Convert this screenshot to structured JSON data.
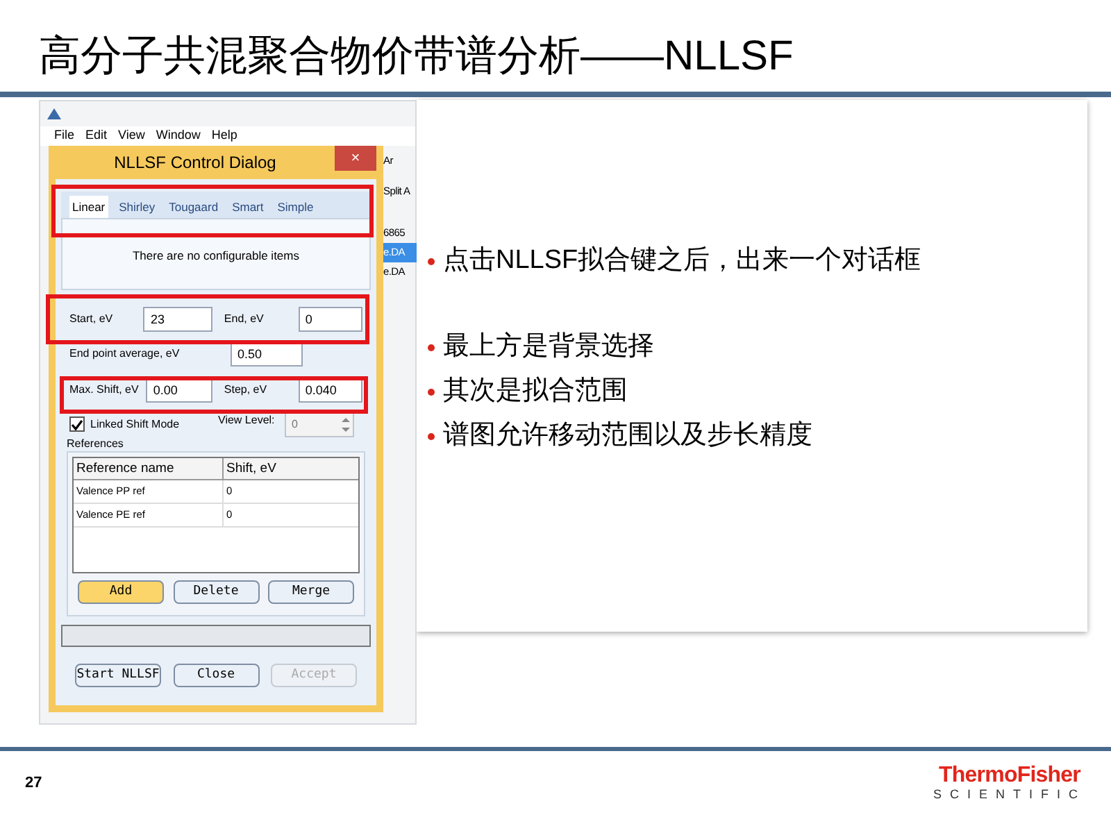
{
  "slide_title": "高分子共混聚合物价带谱分析——NLLSF",
  "app": {
    "menu": [
      "File",
      "Edit",
      "View",
      "Window",
      "Help"
    ],
    "fragments": [
      {
        "text": "Ar",
        "selected": false
      },
      {
        "text": "Split A",
        "selected": false
      },
      {
        "text": "6865",
        "selected": false
      },
      {
        "text": "e.DA",
        "selected": true
      },
      {
        "text": "e.DA",
        "selected": false
      }
    ]
  },
  "dialog": {
    "title": "NLLSF Control Dialog",
    "close": "×",
    "tabs": [
      {
        "label": "Linear",
        "selected": true
      },
      {
        "label": "Shirley",
        "selected": false
      },
      {
        "label": "Tougaard",
        "selected": false
      },
      {
        "label": "Smart",
        "selected": false
      },
      {
        "label": "Simple",
        "selected": false
      }
    ],
    "tab_message": "There are no configurable items",
    "start": {
      "label": "Start, eV",
      "value": "23"
    },
    "end": {
      "label": "End, eV",
      "value": "0"
    },
    "end_point_average": {
      "label": "End point average, eV",
      "value": "0.50"
    },
    "max_shift": {
      "label": "Max. Shift, eV",
      "value": "0.00"
    },
    "step": {
      "label": "Step, eV",
      "value": "0.040"
    },
    "linked_shift": {
      "label": "Linked Shift Mode",
      "checked": true
    },
    "view_level": {
      "label": "View Level:",
      "value": "0",
      "disabled": true
    },
    "references": {
      "label": "References",
      "columns": [
        "Reference name",
        "Shift, eV"
      ],
      "rows": [
        [
          "Valence PP ref",
          "0"
        ],
        [
          "Valence PE ref",
          "0"
        ]
      ]
    },
    "progress": {
      "level": 0
    },
    "ref_buttons": [
      {
        "label": "Add",
        "selected": true,
        "disabled": false
      },
      {
        "label": "Delete",
        "selected": false,
        "disabled": false
      },
      {
        "label": "Merge",
        "selected": false,
        "disabled": false
      }
    ],
    "bottom_buttons": [
      {
        "label": "Start NLLSF",
        "selected": false,
        "disabled": false
      },
      {
        "label": "Close",
        "selected": false,
        "disabled": false
      },
      {
        "label": "Accept",
        "selected": false,
        "disabled": true
      }
    ]
  },
  "bullets": [
    {
      "text": "点击NLLSF拟合键之后，出来一个对话框"
    },
    {
      "text": "最上方是背景选择"
    },
    {
      "text": "其次是拟合范围"
    },
    {
      "text": "谱图允许移动范围以及步长精度"
    }
  ],
  "page_number": "27",
  "logo": {
    "line1": "ThermoFisher",
    "line2": "SCIENTIFIC"
  }
}
